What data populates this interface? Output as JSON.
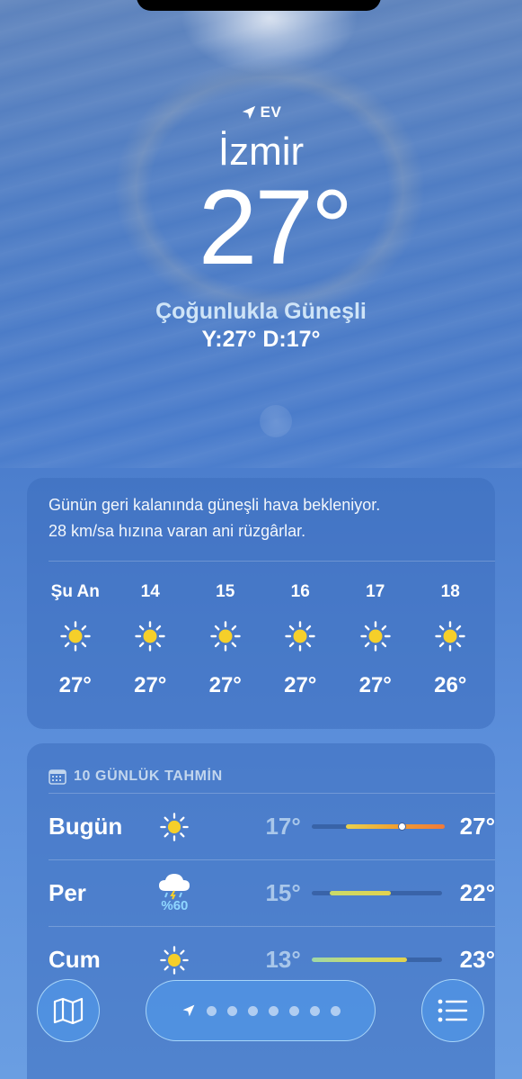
{
  "location": {
    "label": "EV",
    "city": "İzmir",
    "temperature": "27°",
    "condition": "Çoğunlukla Güneşli",
    "high_low": "Y:27° D:17°"
  },
  "hourly": {
    "summary_line1": "Günün geri kalanında güneşli hava bekleniyor.",
    "summary_line2": "28 km/sa hızına varan ani rüzgârlar.",
    "hours": [
      {
        "label": "Şu An",
        "icon": "sun-icon",
        "temp": "27°"
      },
      {
        "label": "14",
        "icon": "sun-icon",
        "temp": "27°"
      },
      {
        "label": "15",
        "icon": "sun-icon",
        "temp": "27°"
      },
      {
        "label": "16",
        "icon": "sun-icon",
        "temp": "27°"
      },
      {
        "label": "17",
        "icon": "sun-icon",
        "temp": "27°"
      },
      {
        "label": "18",
        "icon": "sun-icon",
        "temp": "26°"
      }
    ]
  },
  "daily": {
    "title": "10 GÜNLÜK TAHMİN",
    "days": [
      {
        "name": "Bugün",
        "icon": "sun-icon",
        "low": "17°",
        "high": "27°",
        "pop": ""
      },
      {
        "name": "Per",
        "icon": "cloud-rain-thunder-icon",
        "low": "15°",
        "high": "22°",
        "pop": "%60"
      },
      {
        "name": "Cum",
        "icon": "sun-icon",
        "low": "13°",
        "high": "23°",
        "pop": ""
      }
    ]
  },
  "colors": {
    "sun": "#f5cf2a",
    "accent_light": "#cfe4f7",
    "pop": "#8fd6ff"
  }
}
